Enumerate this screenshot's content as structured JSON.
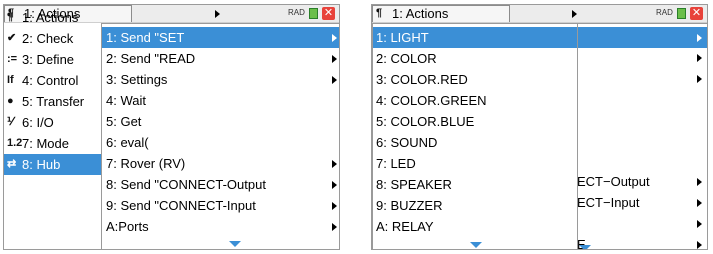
{
  "left": {
    "tab": "1: Actions",
    "status": "RAD",
    "close": "✕",
    "main_menu": [
      {
        "label": "1: Actions",
        "icon": "actions-icon",
        "glyph": "¶"
      },
      {
        "label": "2: Check",
        "icon": "check-icon",
        "glyph": "✔"
      },
      {
        "label": "3: Define",
        "icon": "define-icon",
        "glyph": ":="
      },
      {
        "label": "4: Control",
        "icon": "control-icon",
        "glyph": "If"
      },
      {
        "label": "5: Transfer",
        "icon": "transfer-icon",
        "glyph": "●"
      },
      {
        "label": "6: I/O",
        "icon": "io-icon",
        "glyph": "⅟"
      },
      {
        "label": "7: Mode",
        "icon": "mode-icon",
        "glyph": "1.2"
      },
      {
        "label": "8: Hub",
        "icon": "hub-icon",
        "glyph": "⇄"
      }
    ],
    "submenu": [
      {
        "label": "1: Send \"SET",
        "arrow": true
      },
      {
        "label": "2: Send \"READ",
        "arrow": true
      },
      {
        "label": "3: Settings",
        "arrow": true
      },
      {
        "label": "4: Wait",
        "arrow": false
      },
      {
        "label": "5: Get",
        "arrow": false
      },
      {
        "label": "6: eval(",
        "arrow": false
      },
      {
        "label": "7: Rover (RV)",
        "arrow": true
      },
      {
        "label": "8: Send \"CONNECT-Output",
        "arrow": true
      },
      {
        "label": "9: Send \"CONNECT-Input",
        "arrow": true
      },
      {
        "label": "A:Ports",
        "arrow": true
      }
    ]
  },
  "right": {
    "tab": "1: Actions",
    "status": "RAD",
    "close": "✕",
    "submenu": [
      {
        "label": "1: LIGHT"
      },
      {
        "label": "2: COLOR"
      },
      {
        "label": "3: COLOR.RED"
      },
      {
        "label": "4: COLOR.GREEN"
      },
      {
        "label": "5: COLOR.BLUE"
      },
      {
        "label": "6: SOUND"
      },
      {
        "label": "7: LED"
      },
      {
        "label": "8: SPEAKER"
      },
      {
        "label": "9: BUZZER"
      },
      {
        "label": "A: RELAY"
      }
    ],
    "behind_fragments": [
      "ECT−Output",
      "ECT−Input",
      "E"
    ]
  },
  "colors": {
    "selection": "#3b8fd6",
    "close_button": "#e8423a"
  }
}
